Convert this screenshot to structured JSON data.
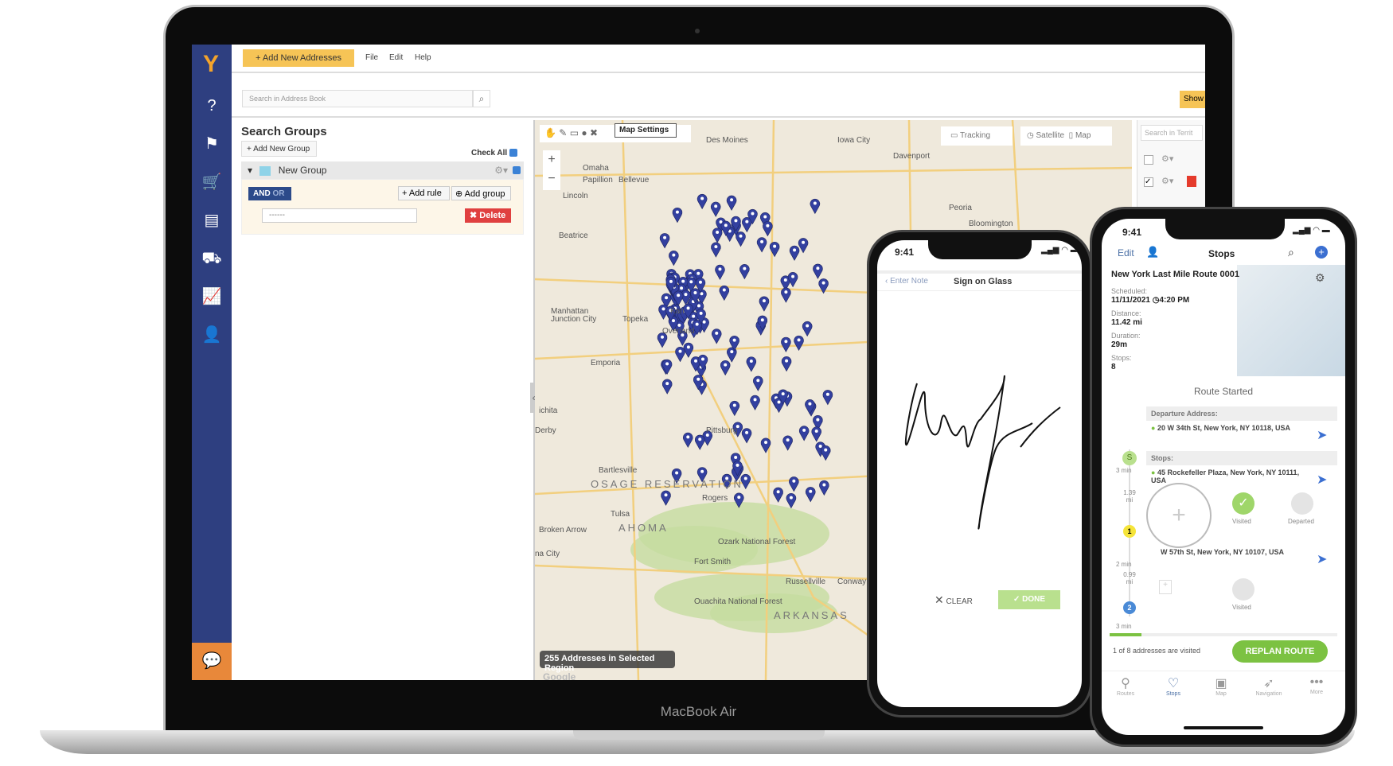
{
  "laptop": {
    "brand": "MacBook Air"
  },
  "app": {
    "sidebar": {
      "icons": [
        "logo-icon",
        "help-icon",
        "routes-icon",
        "cart-icon",
        "orders-icon",
        "fleet-icon",
        "analytics-icon",
        "team-icon",
        "chat-icon"
      ]
    },
    "topbar": {
      "add_addresses": "+ Add New Addresses",
      "menus": [
        "File",
        "Edit",
        "Help"
      ]
    },
    "search": {
      "placeholder": "Search in Address Book",
      "show": "Show"
    },
    "groups": {
      "title": "Search Groups",
      "add_group": "+ Add New Group",
      "check_all": "Check All",
      "group_name": "New Group",
      "group_color": "#8fd3e8",
      "and": "AND",
      "or": "OR",
      "add_rule": "+ Add rule",
      "add_subgroup": "Add group",
      "select_value": "------",
      "delete": "✖ Delete"
    },
    "map": {
      "settings": "Map Settings",
      "tracking": "Tracking",
      "satellite": "Satellite",
      "map": "Map",
      "count_label": "255 Addresses in Selected Region",
      "attribution": "Google",
      "pin_color": "#3340a0",
      "labels": [
        {
          "t": "Des Moines"
        },
        {
          "t": "Iowa City"
        },
        {
          "t": "Davenport"
        },
        {
          "t": "Omaha"
        },
        {
          "t": "Papillion"
        },
        {
          "t": "Bellevue"
        },
        {
          "t": "Lincoln"
        },
        {
          "t": "Peoria"
        },
        {
          "t": "Bloomington"
        },
        {
          "t": "Beatrice"
        },
        {
          "t": "Manhattan"
        },
        {
          "t": "Topeka"
        },
        {
          "t": "Junction City"
        },
        {
          "t": "Kan"
        },
        {
          "t": "Overland"
        },
        {
          "t": "Emporia"
        },
        {
          "t": "ichita"
        },
        {
          "t": "Derby"
        },
        {
          "t": "Pittsburg"
        },
        {
          "t": "Bartlesville"
        },
        {
          "t": "OSAGE RESERVATION"
        },
        {
          "t": "Tulsa"
        },
        {
          "t": "Broken Arrow"
        },
        {
          "t": "AHOMA"
        },
        {
          "t": "na City"
        },
        {
          "t": "Rogers"
        },
        {
          "t": "Fort Smith"
        },
        {
          "t": "Ozark National Forest"
        },
        {
          "t": "Russellville"
        },
        {
          "t": "Conway"
        },
        {
          "t": "Ouachita National Forest"
        },
        {
          "t": "ARKANSAS"
        }
      ]
    },
    "territory": {
      "placeholder": "Search in Territ"
    }
  },
  "phone1": {
    "time": "9:41",
    "back": "Enter Note",
    "title": "Sign on Glass",
    "clear": "CLEAR",
    "done": "DONE"
  },
  "phone2": {
    "time": "9:41",
    "edit": "Edit",
    "title": "Stops",
    "route_name": "New York Last Mile Route 0001",
    "scheduled_label": "Scheduled:",
    "scheduled": "11/11/2021",
    "scheduled_time": "4:20 PM",
    "distance_label": "Distance:",
    "distance": "11.42 mi",
    "duration_label": "Duration:",
    "duration": "29m",
    "stops_label": "Stops:",
    "stops": "8",
    "status": "Route Started",
    "departure_label": "Departure Address:",
    "departure": "20 W 34th St, New York, NY 10118, USA",
    "stops_section": "Stops:",
    "stop1": "45 Rockefeller Plaza, New York, NY 10111, USA",
    "stop2": "W 57th St, New York, NY 10107, USA",
    "timeline": {
      "start": "S",
      "start_time": "3 min",
      "leg1": "1.39 mi",
      "stop1_num": "1",
      "leg1_time": "2 min",
      "leg2": "0.99 mi",
      "stop2_num": "2",
      "leg2_time": "3 min"
    },
    "visited": "Visited",
    "departed": "Departed",
    "visited_summary": "1 of 8 addresses are visited",
    "replan": "REPLAN ROUTE",
    "tabs": [
      {
        "label": "Routes",
        "icon": "routes-icon"
      },
      {
        "label": "Stops",
        "icon": "stops-icon"
      },
      {
        "label": "Map",
        "icon": "map-icon"
      },
      {
        "label": "Navigation",
        "icon": "navigation-icon"
      },
      {
        "label": "More",
        "icon": "more-icon"
      }
    ],
    "accent": "#7cc242"
  }
}
